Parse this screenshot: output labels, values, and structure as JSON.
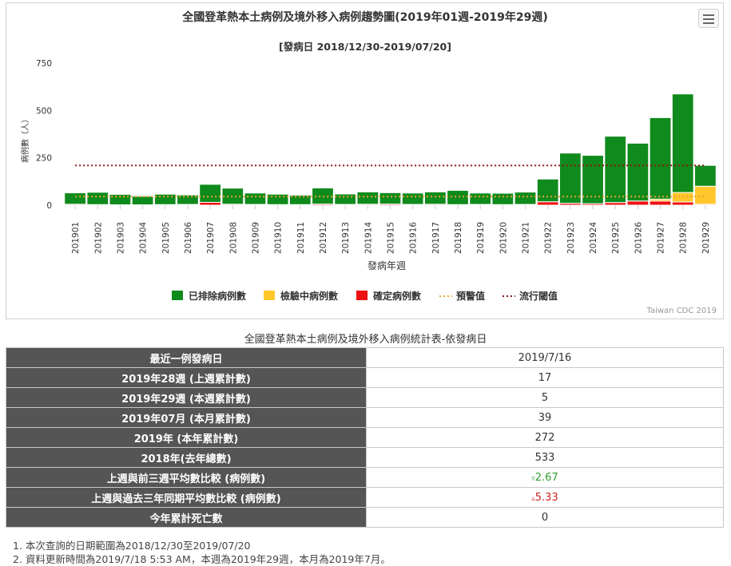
{
  "chart_data": {
    "type": "bar",
    "stacked": true,
    "title": "全國登革熱本土病例及境外移入病例趨勢圖(2019年01週-2019年29週)",
    "subtitle": "[發病日 2018/12/30-2019/07/20]",
    "xlabel": "發病年週",
    "ylabel": "病例數（人）",
    "ylim": [
      0,
      750
    ],
    "yticks": [
      "0",
      "250",
      "500",
      "750"
    ],
    "grid": false,
    "legend_position": "bottom",
    "credit": "Taiwan CDC 2019",
    "categories": [
      "201901",
      "201902",
      "201903",
      "201904",
      "201905",
      "201906",
      "201907",
      "201908",
      "201909",
      "201910",
      "201911",
      "201912",
      "201913",
      "201914",
      "201915",
      "201916",
      "201917",
      "201918",
      "201919",
      "201920",
      "201921",
      "201922",
      "201923",
      "201924",
      "201925",
      "201926",
      "201927",
      "201928",
      "201929"
    ],
    "series": [
      {
        "name": "已排除病例數",
        "color": "#0f8a1c",
        "values": [
          60,
          65,
          55,
          45,
          55,
          50,
          95,
          85,
          60,
          55,
          50,
          85,
          55,
          65,
          60,
          60,
          65,
          75,
          60,
          60,
          65,
          120,
          265,
          255,
          350,
          305,
          430,
          520,
          110
        ]
      },
      {
        "name": "檢驗中病例數",
        "color": "#ffc72c",
        "values": [
          0,
          0,
          0,
          0,
          0,
          0,
          0,
          0,
          0,
          0,
          0,
          0,
          0,
          0,
          0,
          0,
          0,
          0,
          0,
          0,
          0,
          0,
          0,
          0,
          0,
          0,
          10,
          50,
          95
        ]
      },
      {
        "name": "確定病例數",
        "color": "#ee1111",
        "values": [
          5,
          3,
          2,
          2,
          3,
          4,
          15,
          5,
          4,
          3,
          3,
          6,
          4,
          5,
          6,
          4,
          5,
          3,
          4,
          3,
          4,
          18,
          10,
          8,
          14,
          22,
          22,
          17,
          5
        ]
      }
    ],
    "lines": [
      {
        "name": "預警值",
        "color": "#f0a030",
        "values": [
          45,
          45,
          45,
          45,
          45,
          45,
          45,
          45,
          45,
          45,
          45,
          45,
          45,
          45,
          45,
          45,
          45,
          45,
          45,
          45,
          45,
          45,
          45,
          45,
          45,
          45,
          45,
          45,
          45
        ]
      },
      {
        "name": "流行閾值",
        "color": "#8b1a1a",
        "values": [
          210,
          210,
          210,
          210,
          210,
          210,
          210,
          210,
          210,
          210,
          210,
          210,
          210,
          210,
          210,
          210,
          210,
          210,
          210,
          210,
          210,
          210,
          210,
          210,
          210,
          210,
          210,
          210,
          210
        ]
      }
    ]
  },
  "table": {
    "title": "全國登革熱本土病例及境外移入病例統計表-依發病日",
    "rows": [
      {
        "label": "最近一例發病日",
        "value": "2019/7/16"
      },
      {
        "label": "2019年28週 (上週累計數)",
        "value": "17"
      },
      {
        "label": "2019年29週 (本週累計數)",
        "value": "5"
      },
      {
        "label": "2019年07月 (本月累計數)",
        "value": "39"
      },
      {
        "label": "2019年 (本年累計數)",
        "value": "272"
      },
      {
        "label": "2018年(去年總數)",
        "value": "533"
      },
      {
        "label": "上週與前三週平均數比較 (病例數)",
        "arrow": "▿",
        "value": "2.67",
        "trend_color": "#2e9e2e"
      },
      {
        "label": "上週與過去三年同期平均數比較 (病例數)",
        "arrow": "▵",
        "value": "5.33",
        "trend_color": "#cc2222"
      },
      {
        "label": "今年累計死亡數",
        "value": "0"
      }
    ]
  },
  "notes": [
    "1. 本次查詢的日期範圍為2018/12/30至2019/07/20",
    "2. 資料更新時間為2019/7/18 5:53 AM，本週為2019年29週，本月為2019年7月。"
  ]
}
